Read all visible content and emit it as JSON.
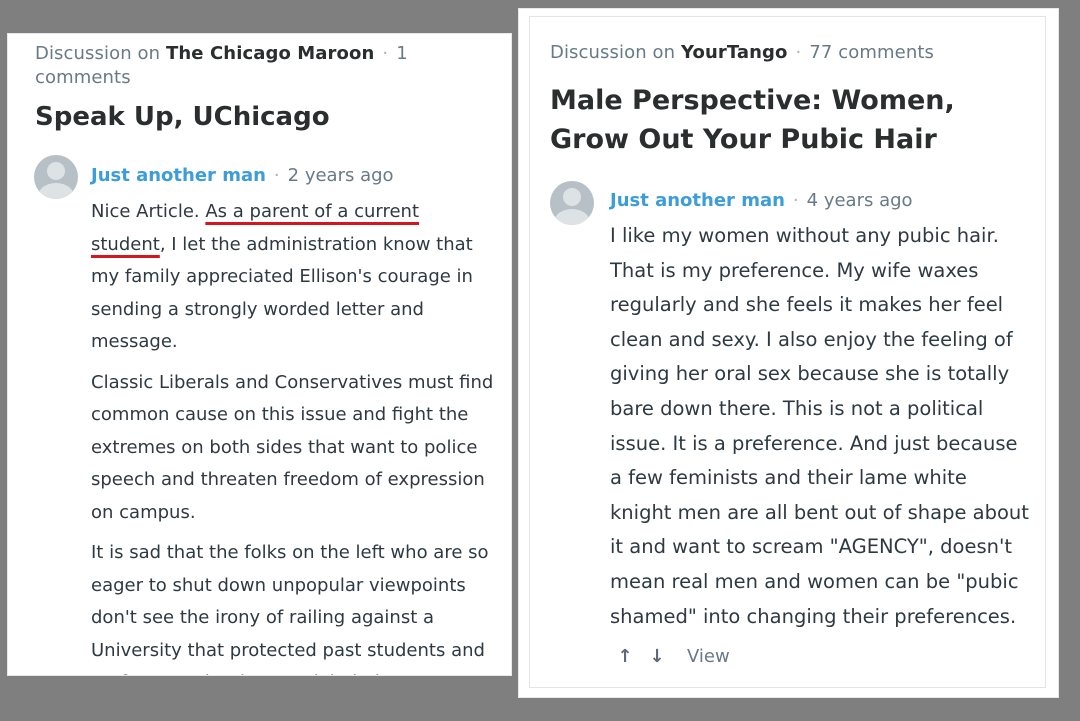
{
  "left": {
    "discussion_prefix": "Discussion on ",
    "site": "The Chicago Maroon",
    "comments_count_line1": "1",
    "comments_count_line2": "comments",
    "title": "Speak Up, UChicago",
    "comment": {
      "author": "Just another man",
      "time": "2 years ago",
      "paragraphs": [
        {
          "before": "Nice Article. ",
          "highlight": "As a parent of a current student",
          "after": ", I let the administration know that my family appreciated Ellison's courage in sending a strongly worded letter and message."
        },
        "Classic Liberals and Conservatives must find common cause on this issue and fight the extremes on both sides that want to police speech and threaten freedom of expression on campus.",
        "It is sad that the folks on the left who are so eager to shut down unpopular viewpoints don't see the irony of railing against a University that protected past students and professors who they are labeled"
      ],
      "highlight_color": "#d4171f"
    }
  },
  "right": {
    "discussion_prefix": "Discussion on ",
    "site": "YourTango",
    "comments_count": "77 comments",
    "title": "Male Perspective: Women, Grow Out Your Pubic Hair",
    "comment": {
      "author": "Just another man",
      "time": "4 years ago",
      "text": "I like my women without any pubic hair. That is my preference. My wife waxes regularly and she feels it makes her feel clean and sexy. I also enjoy the feeling of giving her oral sex because she is totally bare down there. This is not a political issue. It is a preference. And just because a few feminists and their lame white knight men are all bent out of shape about it and want to scream \"AGENCY\", doesn't mean real men and women can be \"pubic shamed\" into changing their preferences."
    },
    "footer": {
      "upvote_icon": "arrow-up-icon",
      "downvote_icon": "arrow-down-icon",
      "upvote_glyph": "↑",
      "downvote_glyph": "↓",
      "view_label": "View"
    }
  },
  "colors": {
    "background": "#7f7f7f",
    "author_link": "#3d9dd8",
    "meta_gray": "#687a86",
    "title_dark": "#2a2e2e",
    "body_text": "#2e3a42"
  }
}
